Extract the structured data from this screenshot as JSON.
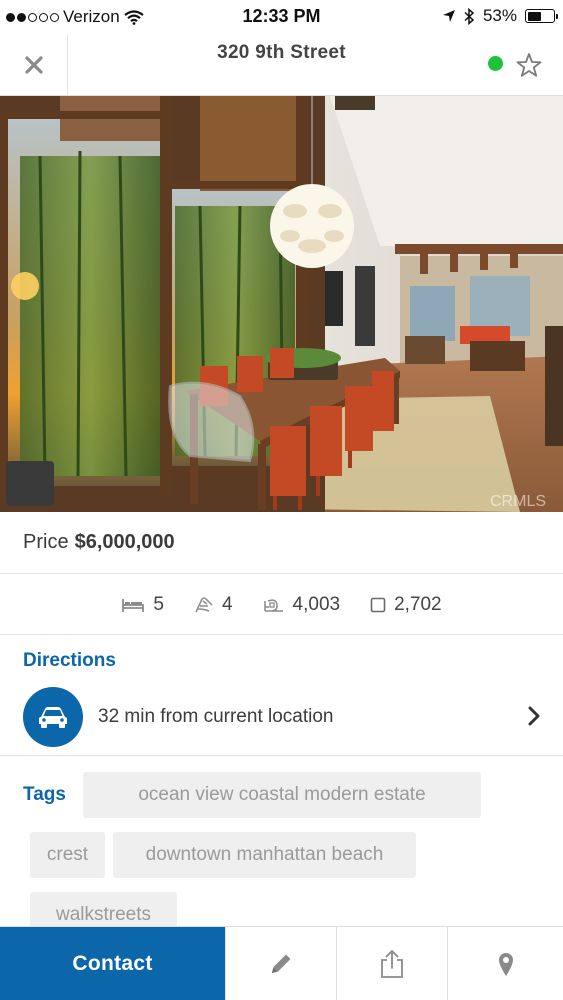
{
  "status_bar": {
    "carrier": "Verizon",
    "time": "12:33 PM",
    "battery_percent": "53%",
    "battery_level": 0.53,
    "signal_bars_filled": 2,
    "signal_bars_total": 5
  },
  "nav": {
    "title": "320 9th Street",
    "status_color": "#1ec23a"
  },
  "hero": {
    "watermark": "CRMLS"
  },
  "listing": {
    "price_label": "Price",
    "price_value": "$6,000,000",
    "beds": "5",
    "baths": "4",
    "sqft": "4,003",
    "lot": "2,702"
  },
  "directions": {
    "heading": "Directions",
    "text": "32 min from current location"
  },
  "tags": {
    "heading": "Tags",
    "items": [
      "ocean view coastal modern estate",
      "crest",
      "downtown manhattan beach",
      "walkstreets"
    ]
  },
  "toolbar": {
    "contact_label": "Contact"
  },
  "colors": {
    "accent": "#0b67aa",
    "online": "#1ec23a"
  },
  "icons": [
    "close-icon",
    "star-icon",
    "bed-icon",
    "bath-icon",
    "sqft-icon",
    "lot-icon",
    "car-icon",
    "chevron-right-icon",
    "pencil-icon",
    "share-icon",
    "map-pin-icon"
  ]
}
